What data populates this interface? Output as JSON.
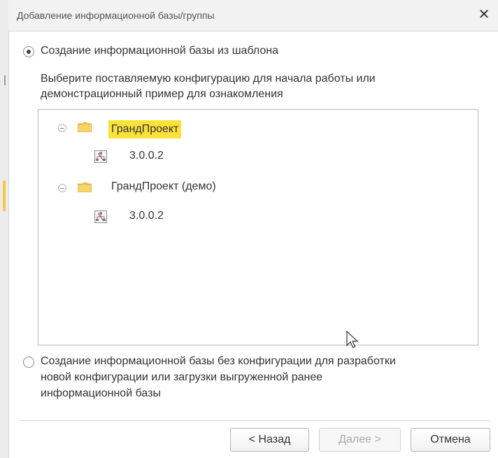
{
  "window": {
    "title": "Добавление информационной базы/группы"
  },
  "option_template": {
    "label": "Создание информационной базы из шаблона",
    "checked": true,
    "description": [
      "Выберите поставляемую конфигурацию для начала работы или",
      "демонстрационный пример для ознакомления"
    ]
  },
  "tree": {
    "items": [
      {
        "label": "ГрандПроект",
        "selected": true,
        "child": {
          "label": "3.0.0.2"
        }
      },
      {
        "label": "ГрандПроект (демо)",
        "selected": false,
        "child": {
          "label": "3.0.0.2"
        }
      }
    ]
  },
  "option_empty": {
    "checked": false,
    "lines": [
      "Создание информационной базы без конфигурации для разработки",
      "новой конфигурации или загрузки выгруженной ранее",
      "информационной базы"
    ]
  },
  "buttons": {
    "back": "< Назад",
    "next": "Далее >",
    "cancel": "Отмена"
  },
  "colors": {
    "selection": "#fbe23b",
    "folder": "#f3c64a"
  },
  "icons": {
    "close": "close-icon",
    "folder": "folder-icon",
    "configuration": "configuration-icon",
    "collapse": "collapse-icon",
    "cursor": "mouse-pointer-icon"
  }
}
